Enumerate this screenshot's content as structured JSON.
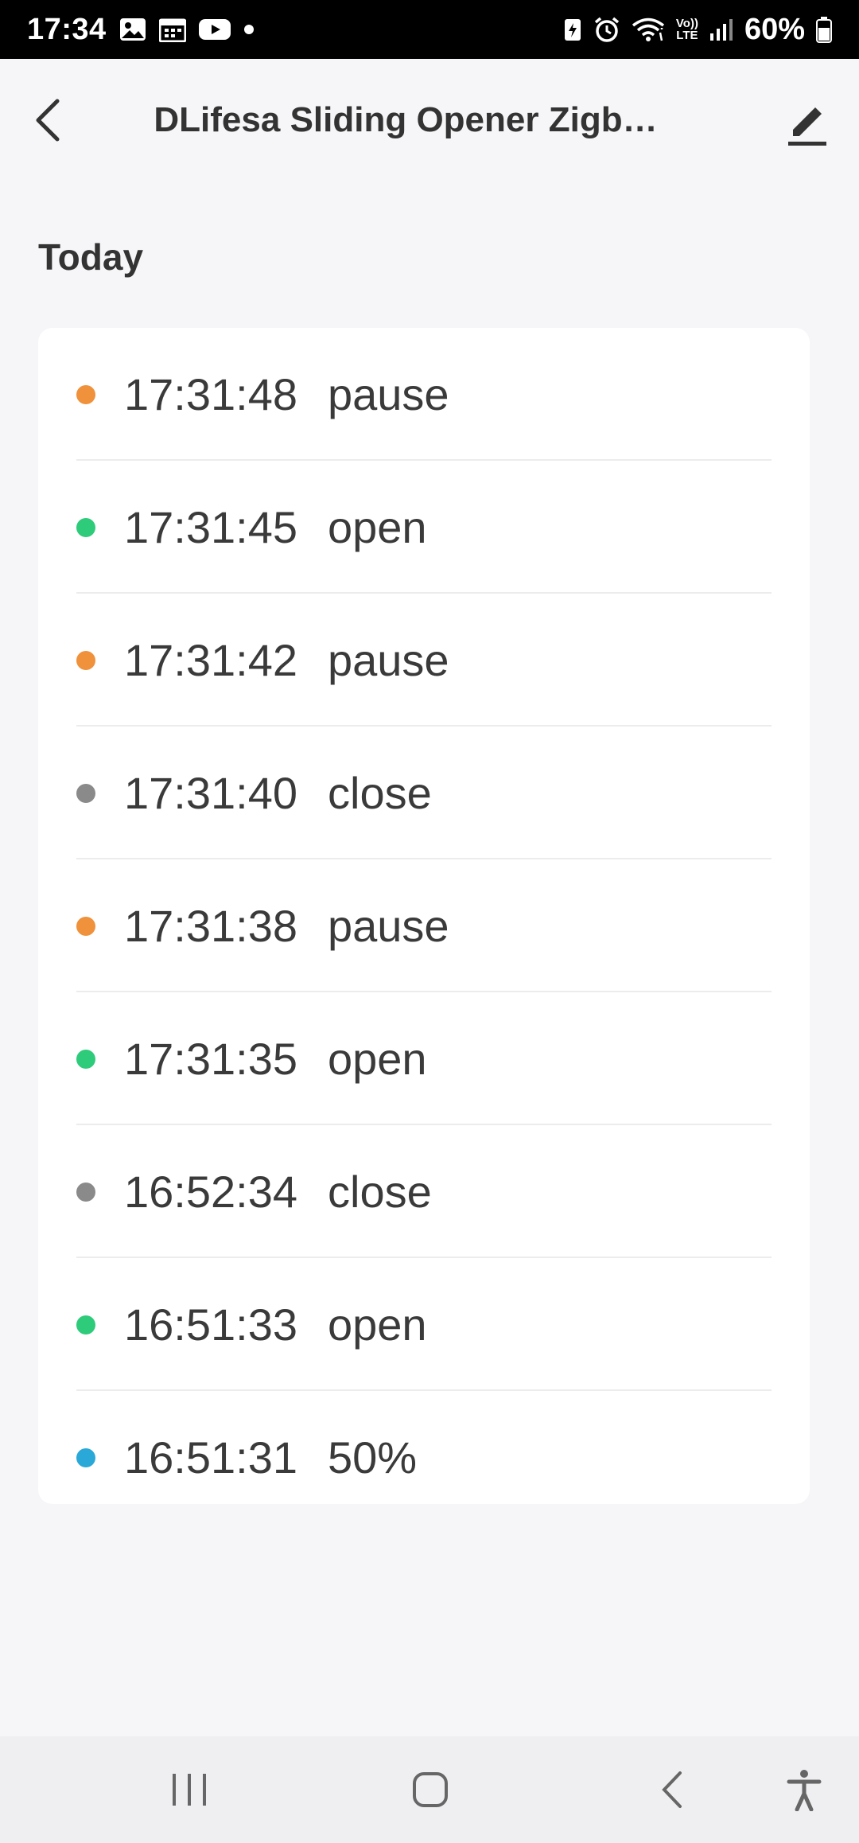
{
  "status_bar": {
    "time": "17:34",
    "battery_pct": "60%",
    "notification_icons": [
      "gallery-icon",
      "calendar-icon",
      "youtube-icon",
      "dot-icon"
    ],
    "system_icons": [
      "battery-saver-icon",
      "alarm-icon",
      "wifi-icon",
      "volte-icon",
      "signal-icon",
      "battery-icon"
    ],
    "network_label_top": "Vo))",
    "network_label_bottom": "LTE"
  },
  "header": {
    "title": "DLifesa Sliding Opener Zigb…",
    "back_icon": "chevron-left-icon",
    "edit_icon": "pencil-icon"
  },
  "section": {
    "title": "Today"
  },
  "colors": {
    "pause": "#f0913b",
    "open": "#2ecb7a",
    "close": "#8a8a8a",
    "percent": "#2aa8d8"
  },
  "logs": [
    {
      "time": "17:31:48",
      "action": "pause",
      "status": "pause"
    },
    {
      "time": "17:31:45",
      "action": "open",
      "status": "open"
    },
    {
      "time": "17:31:42",
      "action": "pause",
      "status": "pause"
    },
    {
      "time": "17:31:40",
      "action": "close",
      "status": "close"
    },
    {
      "time": "17:31:38",
      "action": "pause",
      "status": "pause"
    },
    {
      "time": "17:31:35",
      "action": "open",
      "status": "open"
    },
    {
      "time": "16:52:34",
      "action": "close",
      "status": "close"
    },
    {
      "time": "16:51:33",
      "action": "open",
      "status": "open"
    },
    {
      "time": "16:51:31",
      "action": "50%",
      "status": "percent"
    }
  ],
  "nav_bar": {
    "items": [
      "recents-icon",
      "home-icon",
      "back-icon",
      "accessibility-icon"
    ]
  }
}
